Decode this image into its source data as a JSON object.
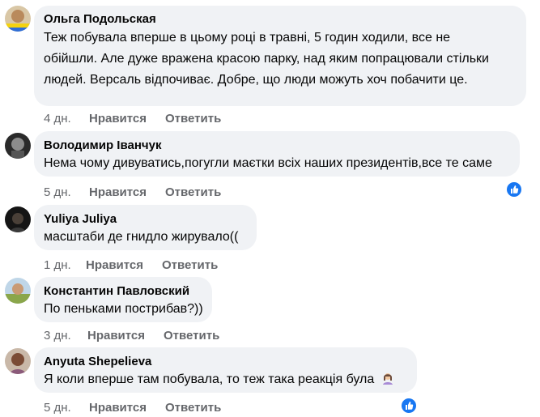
{
  "comments": [
    {
      "author": "Ольга Подольская",
      "text": "Теж побувала вперше в цьому році в травні, 5 годин ходили, все не обійшли. Але дуже вражена красою парку, над яким попрацювали стільки людей. Версаль відпочиває. Добре, що люди можуть хоч побачити це.",
      "time": "4 дн.",
      "like_label": "Нравится",
      "reply_label": "Ответить",
      "reaction": ""
    },
    {
      "author": "Володимир Іванчук",
      "text": "Нема чому дивуватись,погугли маєтки всіх наших президентів,все те саме",
      "time": "5 дн.",
      "like_label": "Нравится",
      "reply_label": "Ответить",
      "reaction": "like-icon"
    },
    {
      "author": "Yuliya Juliya",
      "text": "масштаби де гнидло жирувало((",
      "time": "1 дн.",
      "like_label": "Нравится",
      "reply_label": "Ответить",
      "reaction": ""
    },
    {
      "author": "Константин Павловский",
      "text": "По пеньками пострибав?))",
      "time": "3 дн.",
      "like_label": "Нравится",
      "reply_label": "Ответить",
      "reaction": ""
    },
    {
      "author": "Anyuta Shepelieva",
      "text": "Я коли вперше там побувала, то теж така реакція була",
      "time": "5 дн.",
      "like_label": "Нравится",
      "reply_label": "Ответить",
      "reaction": "like-icon",
      "emoji": "woman-shrugging-icon"
    }
  ],
  "colors": {
    "bubble": "#f0f2f5",
    "meta_text": "#65676b",
    "like_blue": "#1877f2"
  }
}
